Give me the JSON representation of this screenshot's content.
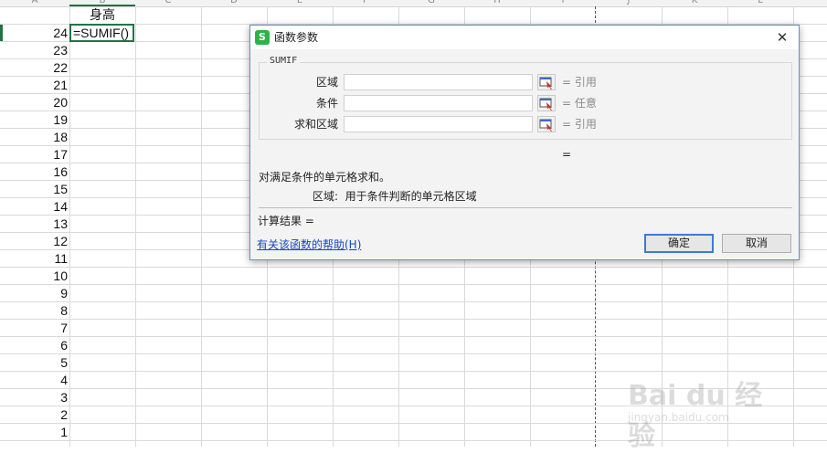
{
  "sheet": {
    "col_letters": [
      "A",
      "B",
      "C",
      "D",
      "E",
      "F",
      "G",
      "H",
      "I",
      "J",
      "K",
      "L"
    ],
    "header_cell": "身高",
    "formula_cell": "=SUMIF()",
    "column_a": [
      "24",
      "23",
      "22",
      "21",
      "20",
      "19",
      "18",
      "17",
      "16",
      "15",
      "14",
      "13",
      "12",
      "11",
      "10",
      "9",
      "8",
      "7",
      "6",
      "5",
      "4",
      "3",
      "2",
      "1"
    ]
  },
  "dialog": {
    "title": "函数参数",
    "close_label": "✕",
    "app_icon_letter": "S",
    "group_label": "SUMIF",
    "args": [
      {
        "label": "区域",
        "result": "= 引用"
      },
      {
        "label": "条件",
        "result": "= 任意"
      },
      {
        "label": "求和区域",
        "result": "= 引用"
      }
    ],
    "result_eq": "=",
    "description": "对满足条件的单元格求和。",
    "arg_description": "区域:  用于条件判断的单元格区域",
    "calc_result": "计算结果 =",
    "help_link": "有关该函数的帮助(H)",
    "ok_label": "确定",
    "cancel_label": "取消"
  },
  "watermark": {
    "text": "Bai du 经验",
    "sub": "jingyan.baidu.com"
  },
  "colors": {
    "selection": "#217346",
    "link": "#1546c5",
    "ok_border": "#3b7bd8"
  }
}
